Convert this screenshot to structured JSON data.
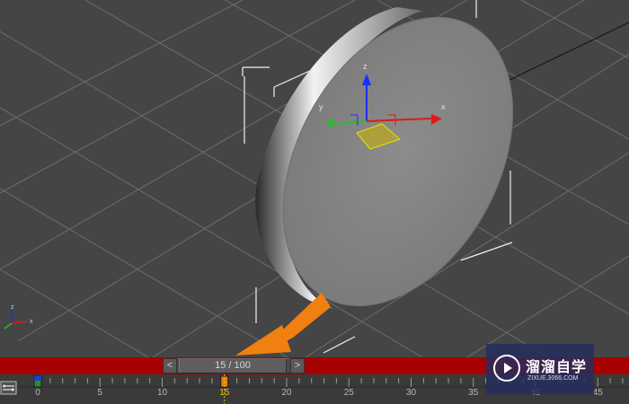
{
  "viewport": {
    "gizmo_labels": {
      "x": "x",
      "y": "y",
      "z": "z"
    },
    "background_color": "#454545",
    "grid_color": "#7a7a7a",
    "object_color": "#8a8a8a"
  },
  "time_slider": {
    "prev_label": "<",
    "next_label": ">",
    "frame_display": "15 / 100",
    "current_frame": 15,
    "total_frames": 100
  },
  "timeline": {
    "labels": [
      "0",
      "5",
      "10",
      "15",
      "20",
      "25",
      "30",
      "35",
      "40",
      "45"
    ],
    "current_frame": 15,
    "keyframes": [
      0,
      15
    ],
    "bar_color": "#a60000"
  },
  "watermark": {
    "title": "溜溜自学",
    "url": "ZIXUE.3066.COM"
  },
  "icons": {
    "trackbar": "filter-icon",
    "watermark_logo": "play-logo-icon",
    "annotation": "arrow-annotation"
  }
}
